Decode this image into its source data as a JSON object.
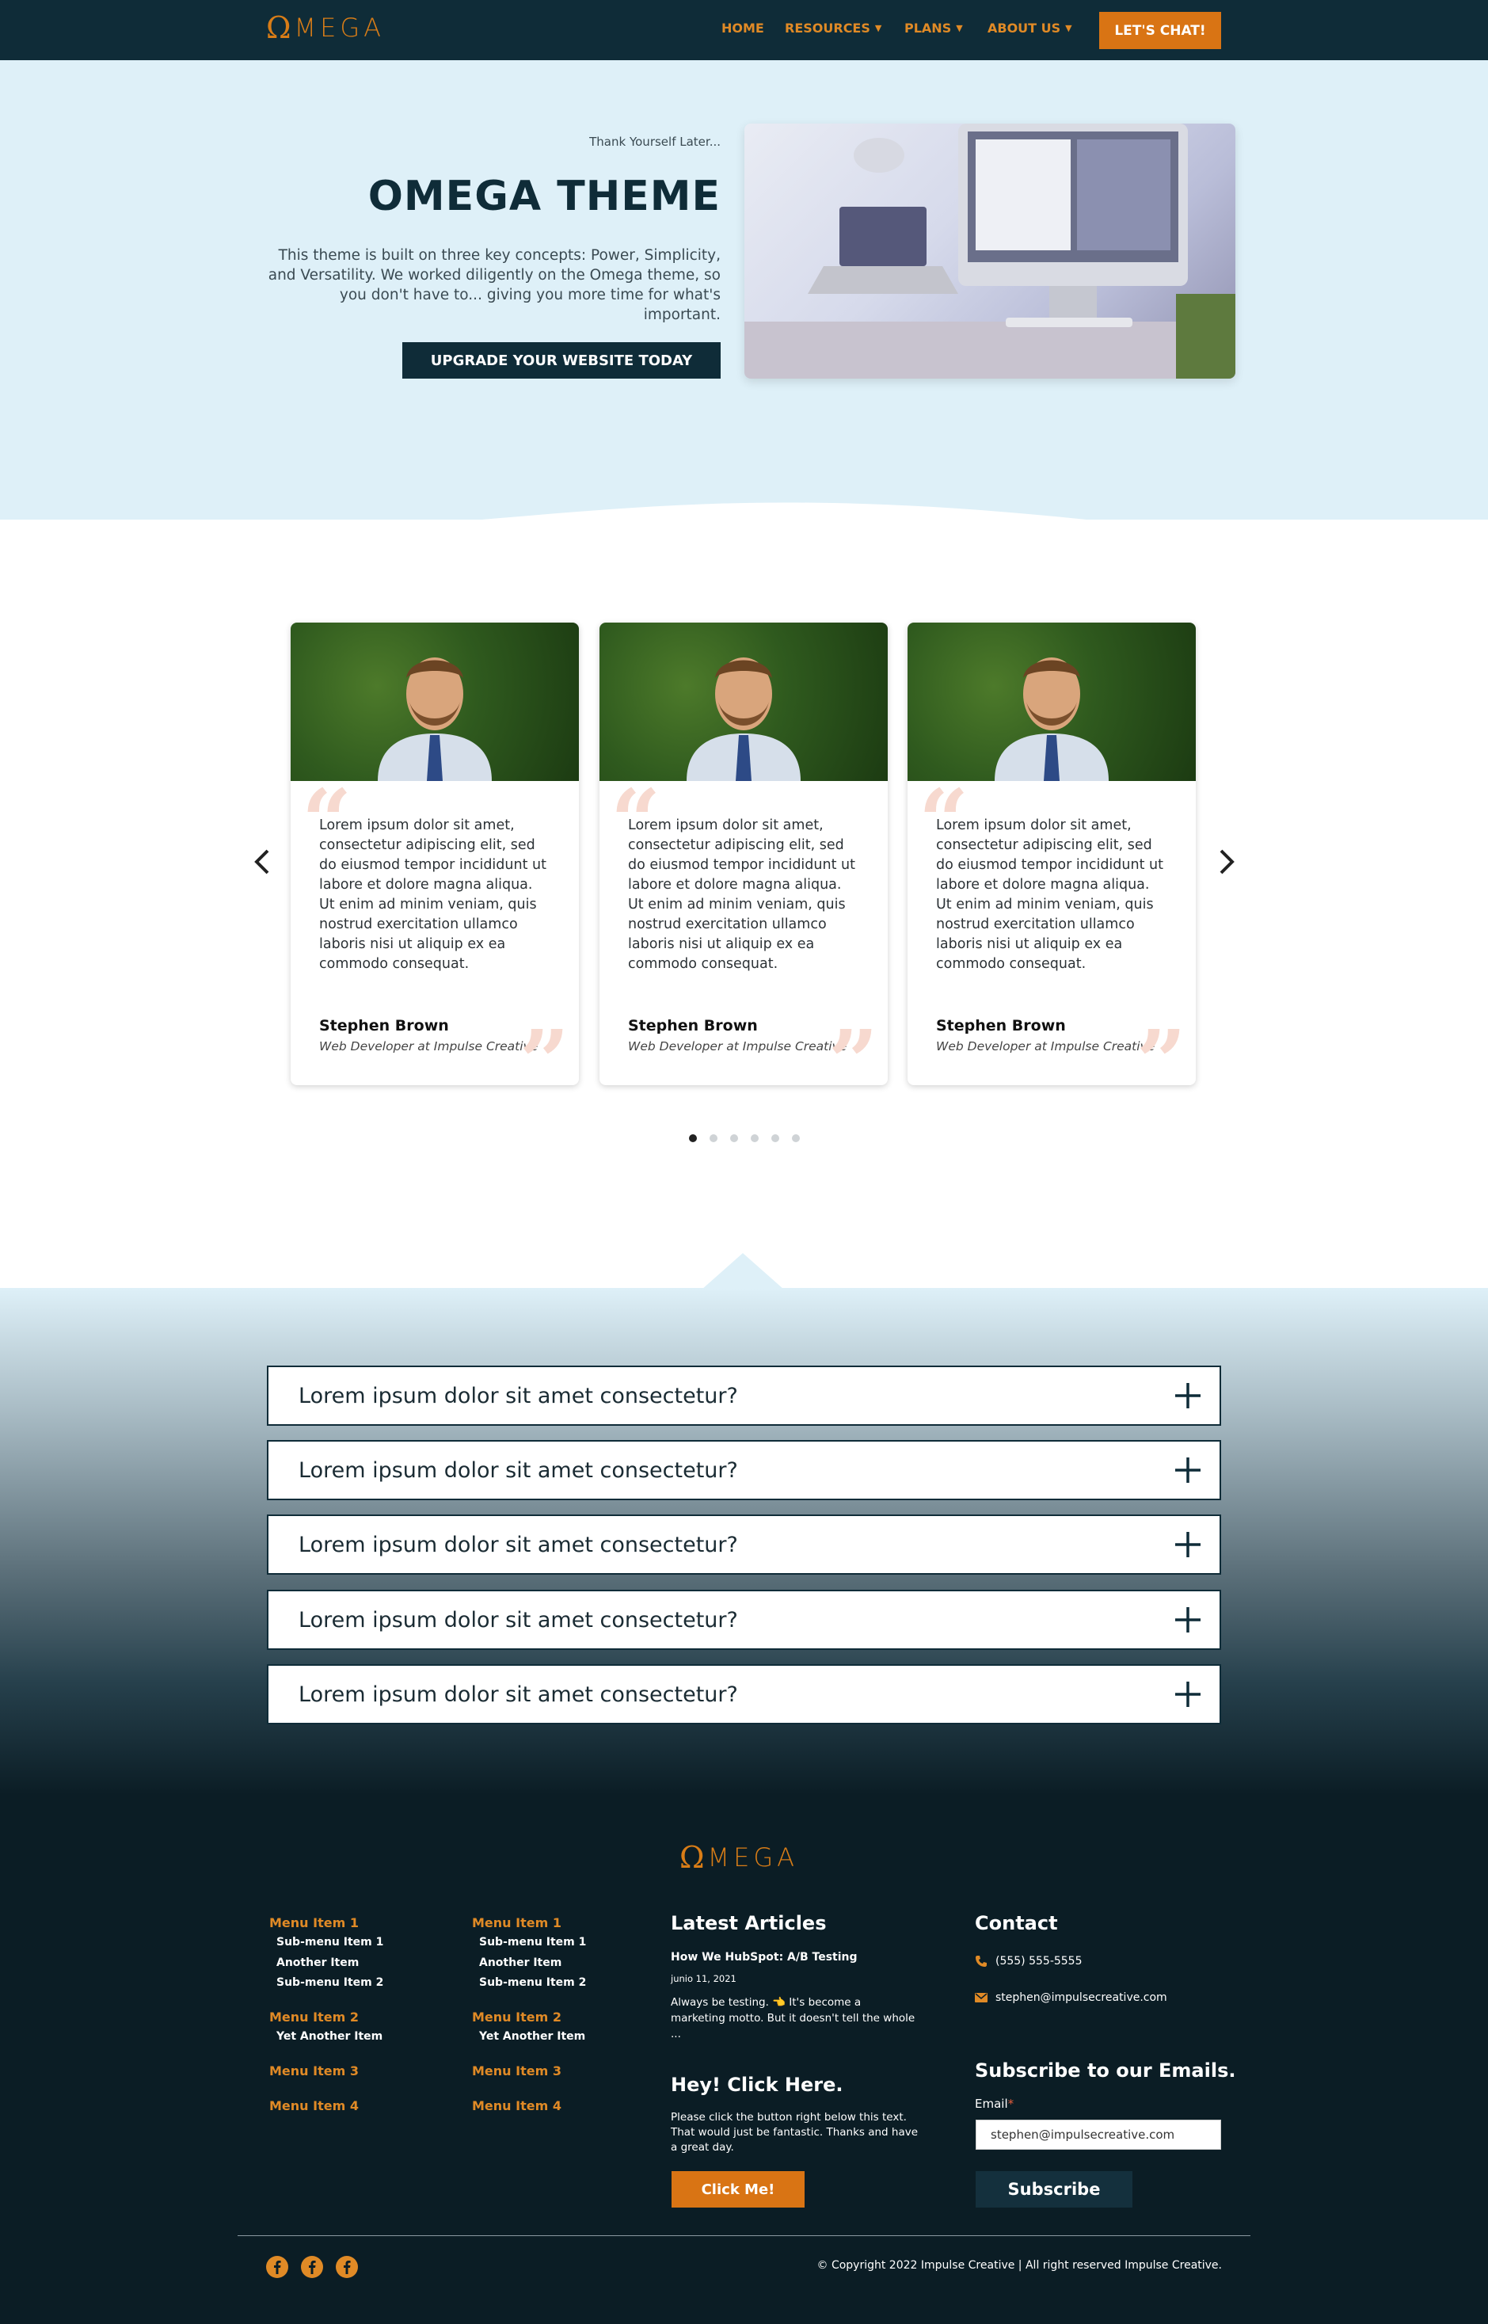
{
  "header": {
    "logo_text": "MEGA",
    "nav": [
      {
        "label": "HOME",
        "has_caret": false
      },
      {
        "label": "RESOURCES",
        "has_caret": true
      },
      {
        "label": "PLANS",
        "has_caret": true
      },
      {
        "label": "ABOUT US",
        "has_caret": true
      }
    ],
    "cta_label": "LET'S CHAT!"
  },
  "hero": {
    "eyebrow": "Thank Yourself Later...",
    "title": "OMEGA THEME",
    "description": "This theme is built on three key concepts: Power, Simplicity, and Versatility. We worked diligently on the Omega theme, so you don't have to... giving you more time for what's important.",
    "button_label": "UPGRADE YOUR WEBSITE TODAY"
  },
  "testimonials": {
    "cards": [
      {
        "text": "Lorem ipsum dolor sit amet, consectetur adipiscing elit, sed do eiusmod tempor incididunt ut labore et dolore magna aliqua. Ut enim ad minim veniam, quis nostrud exercitation ullamco laboris nisi ut aliquip ex ea commodo consequat.",
        "name": "Stephen Brown",
        "role": "Web Developer at Impulse Creative"
      },
      {
        "text": "Lorem ipsum dolor sit amet, consectetur adipiscing elit, sed do eiusmod tempor incididunt ut labore et dolore magna aliqua. Ut enim ad minim veniam, quis nostrud exercitation ullamco laboris nisi ut aliquip ex ea commodo consequat.",
        "name": "Stephen Brown",
        "role": "Web Developer at Impulse Creative"
      },
      {
        "text": "Lorem ipsum dolor sit amet, consectetur adipiscing elit, sed do eiusmod tempor incididunt ut labore et dolore magna aliqua. Ut enim ad minim veniam, quis nostrud exercitation ullamco laboris nisi ut aliquip ex ea commodo consequat.",
        "name": "Stephen Brown",
        "role": "Web Developer at Impulse Creative"
      }
    ],
    "dots_count": 6,
    "active_dot": 0
  },
  "faq": {
    "items": [
      "Lorem ipsum dolor sit amet consectetur?",
      "Lorem ipsum dolor sit amet consectetur?",
      "Lorem ipsum dolor sit amet consectetur?",
      "Lorem ipsum dolor sit amet consectetur?",
      "Lorem ipsum dolor sit amet consectetur?"
    ]
  },
  "footer": {
    "logo_text": "MEGA",
    "menus": [
      {
        "groups": [
          {
            "title": "Menu Item 1",
            "subs": [
              "Sub-menu Item 1",
              "Another Item",
              "Sub-menu Item 2"
            ]
          },
          {
            "title": "Menu Item 2",
            "subs": [
              "Yet Another Item"
            ]
          },
          {
            "title": "Menu Item 3",
            "subs": []
          },
          {
            "title": "Menu Item 4",
            "subs": []
          }
        ]
      },
      {
        "groups": [
          {
            "title": "Menu Item 1",
            "subs": [
              "Sub-menu Item 1",
              "Another Item",
              "Sub-menu Item 2"
            ]
          },
          {
            "title": "Menu Item 2",
            "subs": [
              "Yet Another Item"
            ]
          },
          {
            "title": "Menu Item 3",
            "subs": []
          },
          {
            "title": "Menu Item 4",
            "subs": []
          }
        ]
      }
    ],
    "articles": {
      "heading": "Latest Articles",
      "title": "How We HubSpot: A/B Testing",
      "date": "junio 11, 2021",
      "excerpt": "Always be testing. 👈 It's become a marketing motto. But it doesn't tell the whole ..."
    },
    "click_here": {
      "heading": "Hey! Click Here.",
      "text": "Please click the button right below this text. That would just be fantastic. Thanks and have a great day.",
      "button_label": "Click Me!"
    },
    "contact": {
      "heading": "Contact",
      "phone": "(555) 555-5555",
      "email": "stephen@impulsecreative.com"
    },
    "subscribe": {
      "heading": "Subscribe to our Emails.",
      "email_label": "Email",
      "required_mark": "*",
      "email_value": "stephen@impulsecreative.com",
      "button_label": "Subscribe"
    },
    "social_icons": [
      "facebook-icon",
      "facebook-icon",
      "facebook-icon"
    ],
    "copyright": "© Copyright 2022 Impulse Creative | All right reserved Impulse Creative."
  },
  "colors": {
    "brand_dark": "#0f2c38",
    "accent_orange": "#d97414",
    "hero_bg": "#def0f8"
  }
}
